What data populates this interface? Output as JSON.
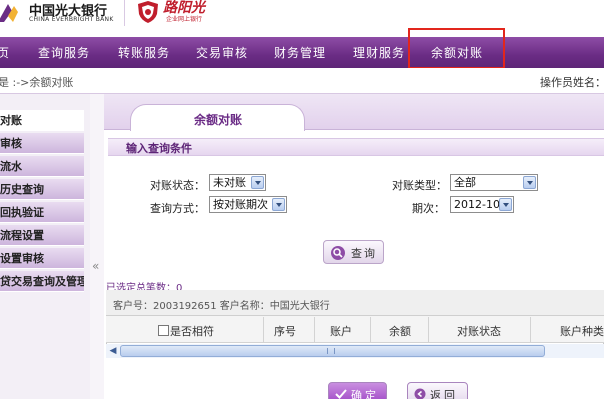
{
  "header": {
    "bank_name_cn": "中国光大银行",
    "bank_name_en": "CHINA EVERBRIGHT BANK",
    "brand_name": "路阳光",
    "brand_sub": "企业网上银行",
    "brand_color": "#c01e2c"
  },
  "nav": {
    "items": [
      "页",
      "查询服务",
      "转账服务",
      "交易审核",
      "财务管理",
      "理财服务",
      "余额对账"
    ],
    "active_index": 6,
    "bar_color": "#6a2c84",
    "highlight_color": "#e2261d"
  },
  "breadcrumb": {
    "text": "是 :->余额对账"
  },
  "operator": {
    "label": "操作员姓名：国"
  },
  "sidebar": {
    "items": [
      "对账",
      "审核",
      "流水",
      "历史查询",
      "回执验证",
      "流程设置",
      "设置审核",
      "贷交易查询及管理"
    ],
    "collapse_glyph": "«"
  },
  "tab": {
    "label": "余额对账"
  },
  "section": {
    "title": "输入查询条件"
  },
  "form": {
    "status_label": "对账状态：",
    "status_value": "未对账",
    "type_label": "对账类型：",
    "type_value": "全部",
    "method_label": "查询方式：",
    "method_value": "按对账期次",
    "period_label": "期次：",
    "period_value": "2012-10"
  },
  "query_button": {
    "label": "查询"
  },
  "results": {
    "count_text": "已选定总笔数：0",
    "account_info": "客户号：2003192651   客户名称：中国光大银行",
    "columns": [
      "是否相符",
      "序号",
      "账户",
      "余额",
      "对账状态",
      "账户种类"
    ]
  },
  "buttons": {
    "confirm": "确定",
    "back": "返回"
  }
}
